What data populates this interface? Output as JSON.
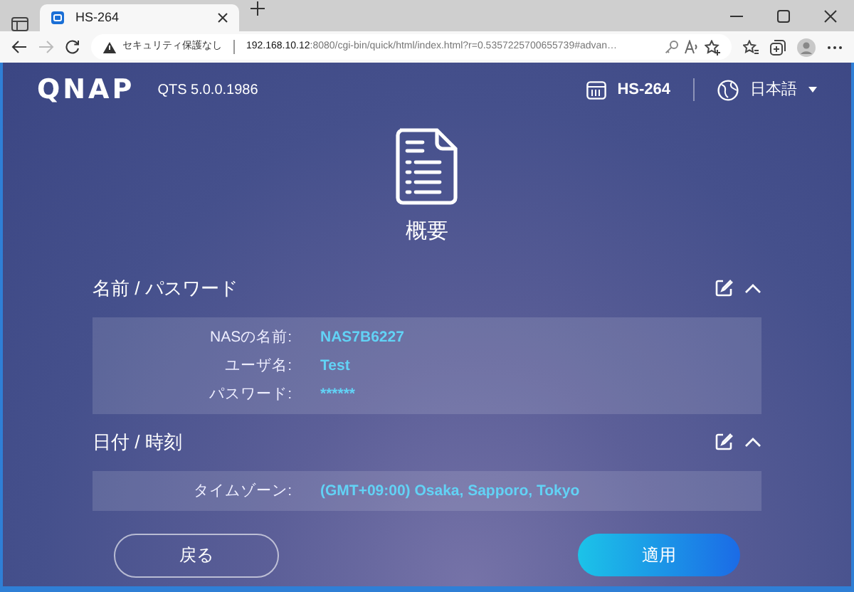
{
  "browser": {
    "tab_title": "HS-264",
    "forward_disabled": true,
    "address": {
      "security_label": "セキュリティ保護なし",
      "url_host": "192.168.10.12",
      "url_rest": ":8080/cgi-bin/quick/html/index.html?r=0.5357225700655739#advan…"
    }
  },
  "header": {
    "logo": "QNAP",
    "version": "QTS 5.0.0.1986",
    "device": "HS-264",
    "language": "日本語"
  },
  "page_title": "概要",
  "sections": [
    {
      "title": "名前 / パスワード",
      "expanded": true,
      "rows": [
        {
          "label": "NASの名前:",
          "value": "NAS7B6227"
        },
        {
          "label": "ユーザ名:",
          "value": "Test"
        },
        {
          "label": "パスワード:",
          "value": "******"
        }
      ]
    },
    {
      "title": "日付 / 時刻",
      "expanded": true,
      "rows": [
        {
          "label": "タイムゾーン:",
          "value": "(GMT+09:00) Osaka, Sapporo, Tokyo"
        }
      ]
    }
  ],
  "buttons": {
    "back": "戻る",
    "apply": "適用"
  }
}
